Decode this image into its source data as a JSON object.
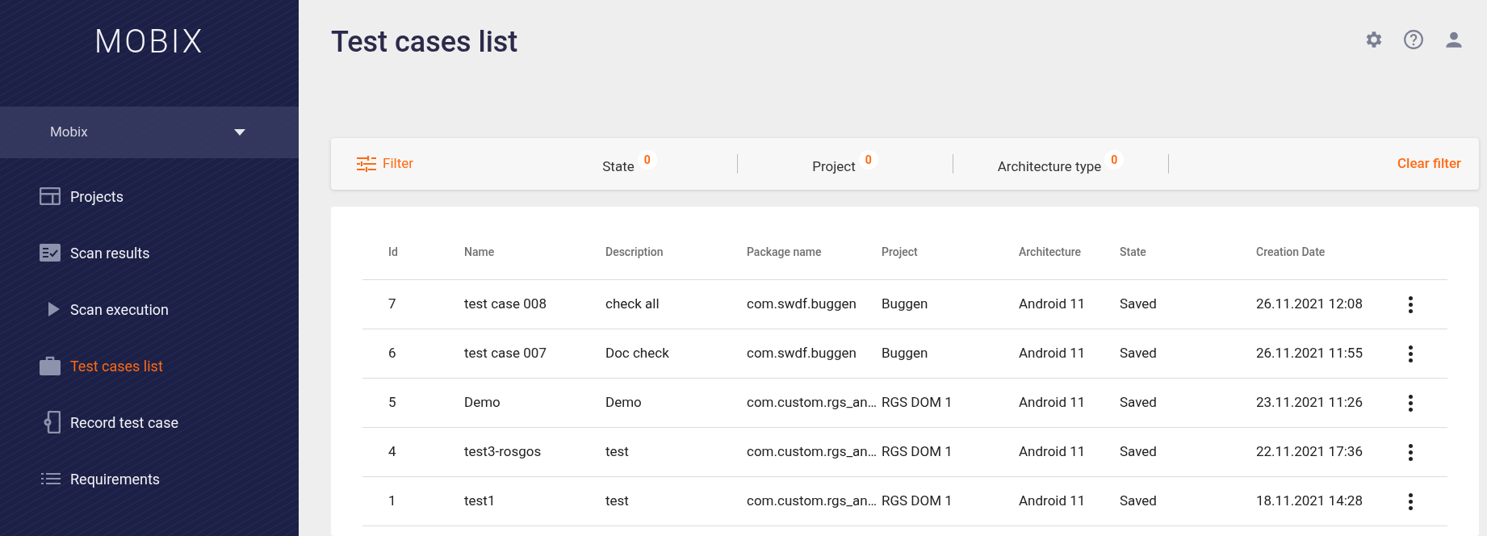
{
  "sidebar": {
    "logo": "MOBIX",
    "project_selector": {
      "value": "Mobix"
    },
    "items": [
      {
        "label": "Projects",
        "selected": false
      },
      {
        "label": "Scan results",
        "selected": false
      },
      {
        "label": "Scan execution",
        "selected": false
      },
      {
        "label": "Test cases list",
        "selected": true
      },
      {
        "label": "Record test case",
        "selected": false
      },
      {
        "label": "Requirements",
        "selected": false
      }
    ]
  },
  "page_title": "Test cases list",
  "filter_bar": {
    "filter_label": "Filter",
    "filters": [
      {
        "label": "State",
        "count": "0"
      },
      {
        "label": "Project",
        "count": "0"
      },
      {
        "label": "Architecture type",
        "count": "0"
      }
    ],
    "clear_label": "Clear filter"
  },
  "table": {
    "columns": [
      "Id",
      "Name",
      "Description",
      "Package name",
      "Project",
      "Architecture",
      "State",
      "Creation Date"
    ],
    "rows": [
      [
        "7",
        "test case 008",
        "check all",
        "com.swdf.buggen",
        "Buggen",
        "Android 11",
        "Saved",
        "26.11.2021 12:08"
      ],
      [
        "6",
        "test case 007",
        "Doc check",
        "com.swdf.buggen",
        "Buggen",
        "Android 11",
        "Saved",
        "26.11.2021 11:55"
      ],
      [
        "5",
        "Demo",
        "Demo",
        "com.custom.rgs_an…",
        "RGS DOM 1",
        "Android 11",
        "Saved",
        "23.11.2021 11:26"
      ],
      [
        "4",
        "test3-rosgos",
        "test",
        "com.custom.rgs_an…",
        "RGS DOM 1",
        "Android 11",
        "Saved",
        "22.11.2021 17:36"
      ],
      [
        "1",
        "test1",
        "test",
        "com.custom.rgs_an…",
        "RGS DOM 1",
        "Android 11",
        "Saved",
        "18.11.2021 14:28"
      ]
    ]
  }
}
